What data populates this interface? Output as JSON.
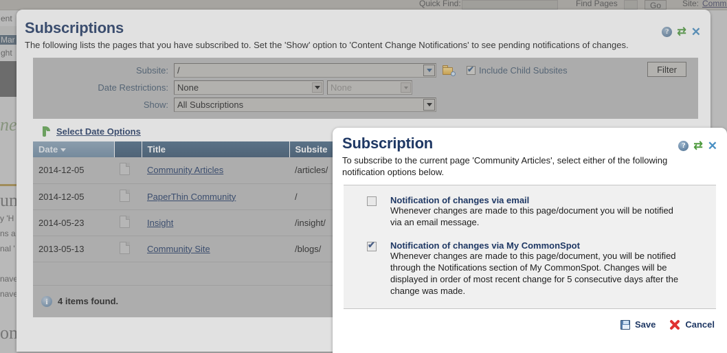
{
  "background": {
    "topbar": {
      "quick_find_label": "Quick Find:",
      "quick_find_value": "",
      "find_pages_label": "Find Pages",
      "go_label": "Go",
      "site_label": "Site:",
      "site_link": "Commu"
    },
    "left_nav": [
      {
        "label": "ent",
        "selected": false
      },
      {
        "label": "Mar",
        "selected": true
      },
      {
        "label": "ght",
        "selected": false
      }
    ],
    "page_fragments": [
      "ne",
      "um",
      "y 'H",
      "ns a",
      "nal '",
      "nave",
      "nave",
      "om"
    ]
  },
  "subscriptions_dialog": {
    "title": "Subscriptions",
    "intro": "The following lists the pages that you have subscribed to. Set the 'Show' option to 'Content Change Notifications' to see pending notifications of changes.",
    "icons": {
      "help": "help-icon",
      "swap": "swap-icon",
      "close": "close-icon"
    },
    "filter": {
      "subsite_label": "Subsite:",
      "subsite_value": "/",
      "subsite_browse_icon": "folder-search-icon",
      "include_child_subsites_label": "Include Child Subsites",
      "include_child_subsites_checked": true,
      "date_restrictions_label": "Date Restrictions:",
      "date_restrictions_value": "None",
      "date_restrictions_secondary_value": "None",
      "show_label": "Show:",
      "show_value": "All Subscriptions",
      "filter_button_label": "Filter"
    },
    "select_date_options_label": "Select Date Options",
    "table": {
      "columns": [
        "Date",
        "",
        "Title",
        "Subsite"
      ],
      "sorted_column": "Date",
      "sort_direction": "desc",
      "rows": [
        {
          "date": "2014-12-05",
          "title": "Community Articles",
          "subsite": "/articles/"
        },
        {
          "date": "2014-12-05",
          "title": "PaperThin Community",
          "subsite": "/"
        },
        {
          "date": "2014-05-23",
          "title": "Insight",
          "subsite": "/insight/"
        },
        {
          "date": "2013-05-13",
          "title": "Community Site",
          "subsite": "/blogs/"
        }
      ]
    },
    "status": "4 items found."
  },
  "subscription_dialog": {
    "title": "Subscription",
    "intro": "To subscribe to the current page 'Community Articles', select either of the following notification options below.",
    "icons": {
      "help": "help-icon",
      "swap": "swap-icon",
      "close": "close-icon"
    },
    "options": [
      {
        "checked": false,
        "title": "Notification of changes via email",
        "desc": "Whenever changes are made to this page/document you will be notified via an email message."
      },
      {
        "checked": true,
        "title": "Notification of changes via My CommonSpot",
        "desc": "Whenever changes are made to this page/document, you will be notified through the Notifications section of My CommonSpot. Changes will be displayed in order of most recent change for 5 consecutive days after the change was made."
      }
    ],
    "actions": {
      "save_label": "Save",
      "cancel_label": "Cancel"
    }
  },
  "colors": {
    "dialog_title": "#1f3864",
    "table_header": "#3b5670",
    "link": "#1f3864",
    "filter_panel": "#b8b8b8",
    "cancel_red": "#e03131",
    "swap_green": "#4f9b3f"
  }
}
